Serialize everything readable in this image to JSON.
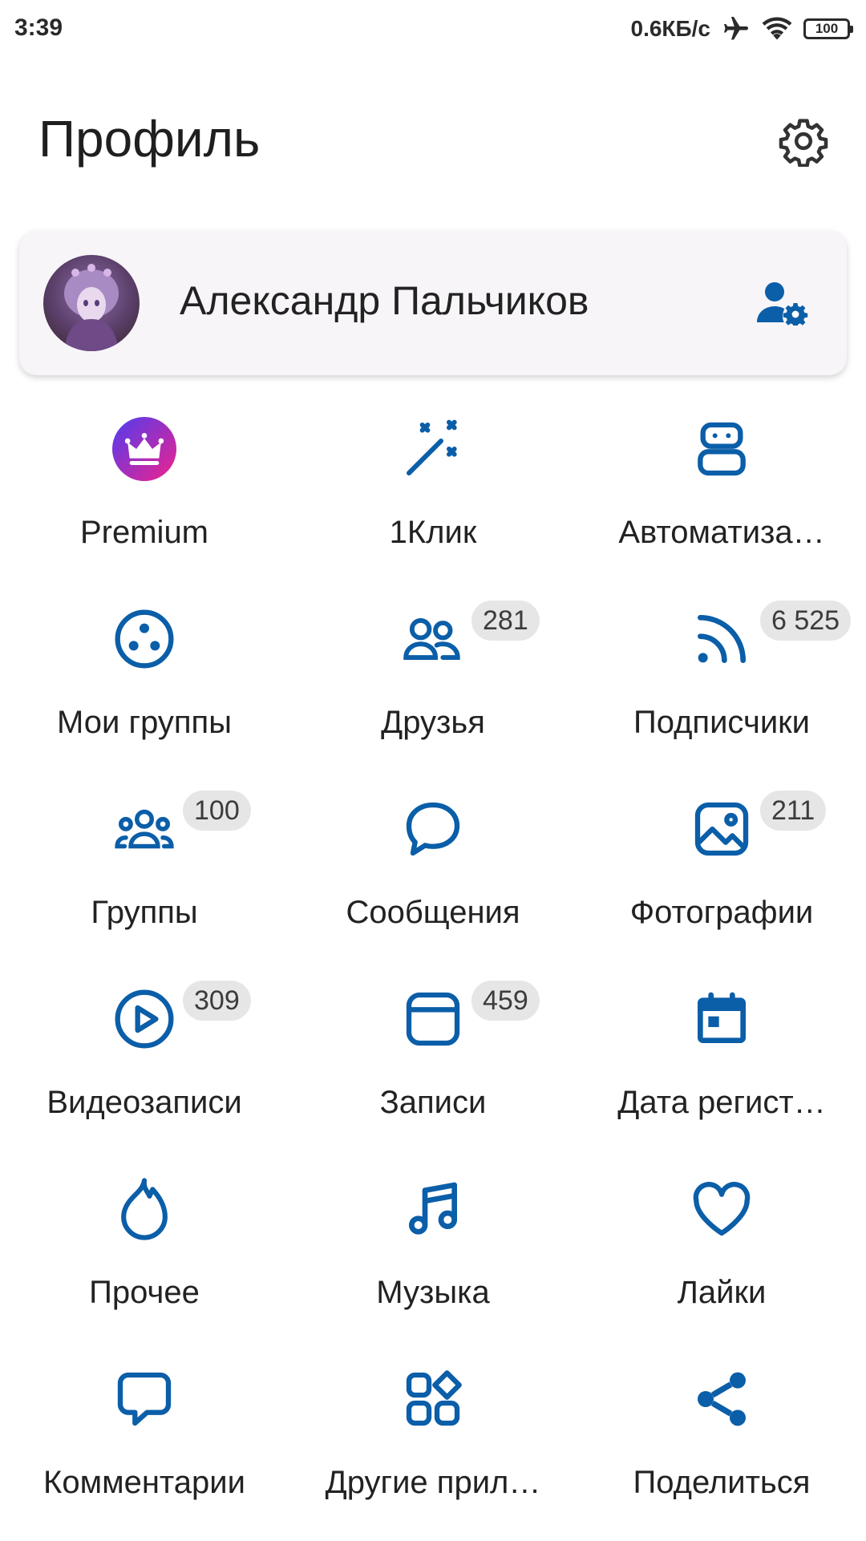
{
  "status_bar": {
    "time": "3:39",
    "network_speed": "0.6КБ/с",
    "battery_level": "100",
    "icons": [
      "airplane-mode-icon",
      "wifi-icon",
      "battery-icon"
    ]
  },
  "header": {
    "title": "Профиль",
    "settings_icon": "gear-icon"
  },
  "profile": {
    "name": "Александр Пальчиков",
    "account_settings_icon": "user-settings-icon"
  },
  "colors": {
    "accent": "#0b5ea8",
    "badge_bg": "#e6e6e6",
    "premium_gradient_start": "#4f3cf0",
    "premium_gradient_end": "#f0228c"
  },
  "tiles": [
    {
      "label": "Premium",
      "icon": "premium-crown-icon",
      "badge": ""
    },
    {
      "label": "1Клик",
      "icon": "magic-wand-icon",
      "badge": ""
    },
    {
      "label": "Автоматиза…",
      "icon": "robot-icon",
      "badge": ""
    },
    {
      "label": "Мои группы",
      "icon": "my-groups-icon",
      "badge": ""
    },
    {
      "label": "Друзья",
      "icon": "friends-icon",
      "badge": "281"
    },
    {
      "label": "Подписчики",
      "icon": "rss-icon",
      "badge": "6 525"
    },
    {
      "label": "Группы",
      "icon": "groups-icon",
      "badge": "100"
    },
    {
      "label": "Сообщения",
      "icon": "message-bubble-icon",
      "badge": ""
    },
    {
      "label": "Фотографии",
      "icon": "photo-icon",
      "badge": "211"
    },
    {
      "label": "Видеозаписи",
      "icon": "play-circle-icon",
      "badge": "309"
    },
    {
      "label": "Записи",
      "icon": "posts-icon",
      "badge": "459"
    },
    {
      "label": "Дата регист…",
      "icon": "calendar-icon",
      "badge": ""
    },
    {
      "label": "Прочее",
      "icon": "flame-icon",
      "badge": ""
    },
    {
      "label": "Музыка",
      "icon": "music-note-icon",
      "badge": ""
    },
    {
      "label": "Лайки",
      "icon": "heart-icon",
      "badge": ""
    },
    {
      "label": "Комментарии",
      "icon": "comment-icon",
      "badge": ""
    },
    {
      "label": "Другие прил…",
      "icon": "apps-icon",
      "badge": ""
    },
    {
      "label": "Поделиться",
      "icon": "share-icon",
      "badge": ""
    }
  ]
}
